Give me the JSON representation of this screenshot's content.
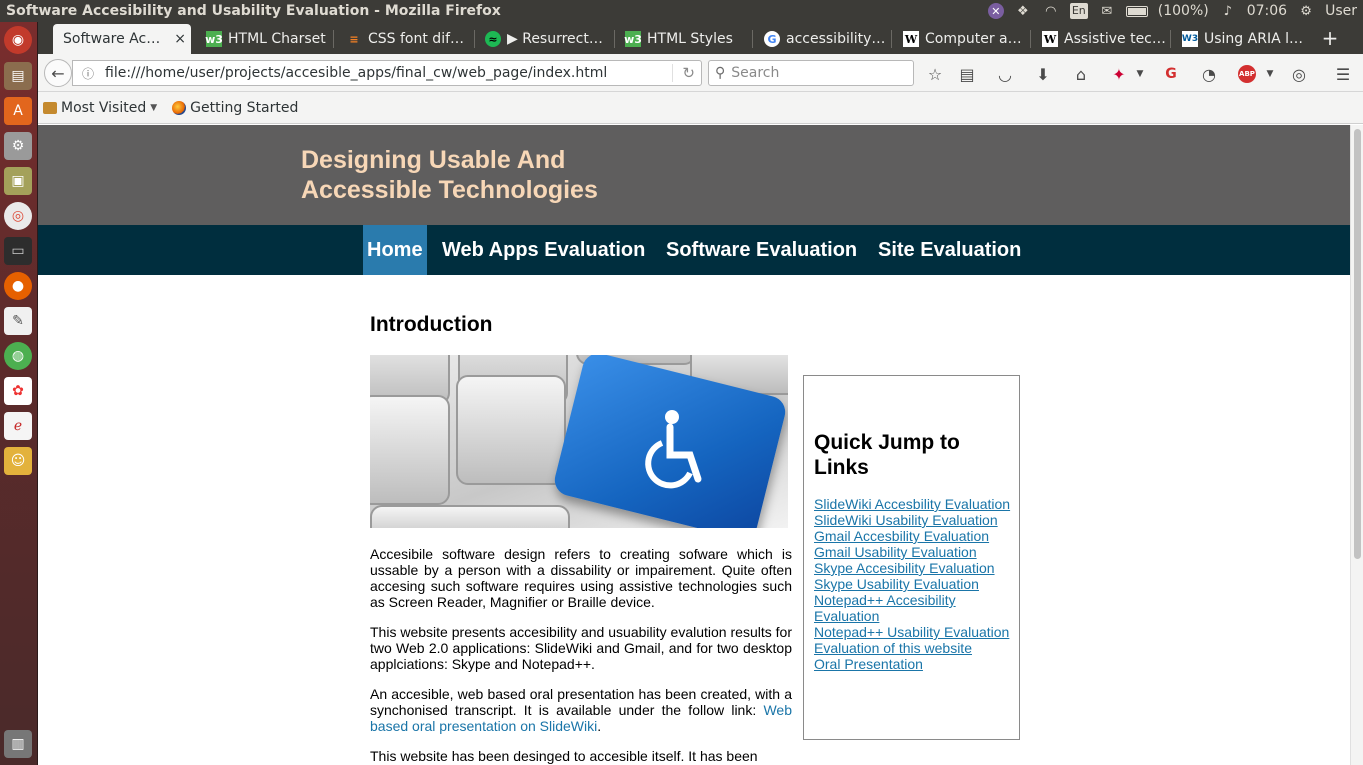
{
  "desktop": {
    "window_title": "Software Accesibility and Usability Evaluation - Mozilla Firefox",
    "indicators": {
      "keyboard_layout": "En",
      "battery": "(100%)",
      "clock": "07:06",
      "user": "User"
    }
  },
  "browser": {
    "tabs": [
      {
        "label": "Software Ac…",
        "icon": "none",
        "active": true
      },
      {
        "label": "HTML Charset",
        "icon": "w3schools-icon"
      },
      {
        "label": "CSS font dif…",
        "icon": "stackoverflow-icon"
      },
      {
        "label": "▶ Resurrect…",
        "icon": "spotify-icon"
      },
      {
        "label": "HTML Styles",
        "icon": "w3schools-icon"
      },
      {
        "label": "accessibility…",
        "icon": "google-icon"
      },
      {
        "label": "Computer a…",
        "icon": "wikipedia-icon"
      },
      {
        "label": "Assistive tec…",
        "icon": "wikipedia-icon"
      },
      {
        "label": "Using ARIA l…",
        "icon": "w3c-icon"
      }
    ],
    "tab_close": "×",
    "new_tab": "+",
    "url": "file:///home/user/projects/accesible_apps/final_cw/web_page/index.html",
    "search_placeholder": "Search",
    "bookmarks": [
      {
        "label": "Most Visited",
        "icon": "folder-icon",
        "dropdown": true
      },
      {
        "label": "Getting Started",
        "icon": "firefox-icon"
      }
    ]
  },
  "site": {
    "title_line1": "Designing Usable And",
    "title_line2": "Accessible Technologies",
    "nav": [
      {
        "label": "Home",
        "active": true
      },
      {
        "label": "Web Apps Evaluation"
      },
      {
        "label": "Software Evaluation"
      },
      {
        "label": "Site Evaluation"
      }
    ],
    "main": {
      "heading": "Introduction",
      "hero_alt": "keyboard with accessibility key",
      "paragraphs": {
        "p1": "Accesibile software design refers to creating sofware which is ussable by a person with a dissability or impairement. Quite often accesing such software requires using assistive technologies such as Screen Reader, Magnifier or Braille device.",
        "p2": "This website presents accesibility and usuability evalution results for two Web 2.0 applications: SlideWiki and Gmail, and for two desktop applciations: Skype and Notepad++.",
        "p3_text": "An accesible, web based oral presentation has been created, with a synchonised transcript. It is available under the follow link: ",
        "p3_link": "Web based oral presentation on SlideWiki",
        "p3_end": ".",
        "p4": "This website has been desinged to accesible itself. It has been"
      }
    },
    "quick_jump": {
      "heading": "Quick Jump to Links",
      "links": [
        "SlideWiki Accesbility Evaluation",
        "SlideWiki Usability Evaluation",
        "Gmail Accesbility Evaluation",
        "Gmail Usability Evaluation",
        "Skype Accesibility Evaluation",
        "Skype Usability Evaluation",
        "Notepad++ Accesibility Evaluation",
        "Notepad++ Usability Evaluation",
        "Evaluation of this website",
        "Oral Presentation"
      ]
    }
  },
  "colors": {
    "header_bg": "#5f5e5e",
    "title_color": "#f7d7b7",
    "nav_bg": "#002e3e",
    "nav_active": "#2a7bad",
    "link": "#1a75a8"
  }
}
